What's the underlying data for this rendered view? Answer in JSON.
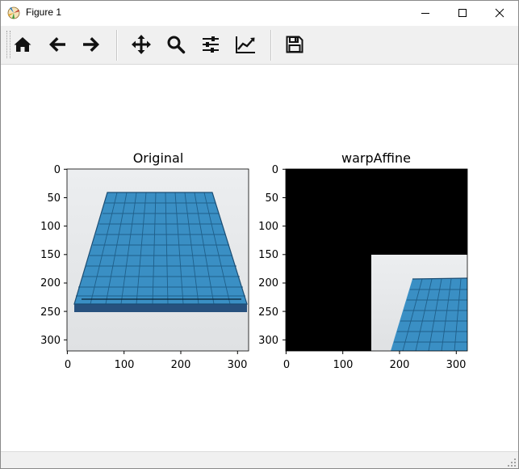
{
  "window": {
    "title": "Figure 1",
    "controls": [
      "minimize",
      "maximize",
      "close"
    ]
  },
  "toolbar": {
    "buttons": [
      {
        "name": "home",
        "icon": "home-icon"
      },
      {
        "name": "back",
        "icon": "arrow-left-icon"
      },
      {
        "name": "forward",
        "icon": "arrow-right-icon"
      },
      {
        "name": "pan",
        "icon": "move-icon"
      },
      {
        "name": "zoom",
        "icon": "magnifier-icon"
      },
      {
        "name": "configure-subplots",
        "icon": "sliders-icon"
      },
      {
        "name": "edit-axes",
        "icon": "line-chart-icon"
      },
      {
        "name": "save",
        "icon": "floppy-disk-icon"
      }
    ]
  },
  "figure": {
    "subplots": [
      {
        "title": "Original",
        "x_ticks": [
          "0",
          "100",
          "200",
          "300"
        ],
        "y_ticks": [
          "0",
          "50",
          "100",
          "150",
          "200",
          "250",
          "300"
        ],
        "xlim": [
          0,
          320
        ],
        "ylim": [
          320,
          0
        ],
        "content": "photo of blue grid board on white background"
      },
      {
        "title": "warpAffine",
        "x_ticks": [
          "0",
          "100",
          "200",
          "300"
        ],
        "y_ticks": [
          "0",
          "50",
          "100",
          "150",
          "200",
          "250",
          "300"
        ],
        "xlim": [
          0,
          320
        ],
        "ylim": [
          320,
          0
        ],
        "content": "translated image, black fill elsewhere"
      }
    ]
  },
  "colors": {
    "board_blue": "#3a8fc4",
    "board_dark": "#2a6e9e",
    "photo_bg": "#e6e7ea",
    "warp_fill": "#000000",
    "toolbar_bg": "#f0f0f0"
  }
}
